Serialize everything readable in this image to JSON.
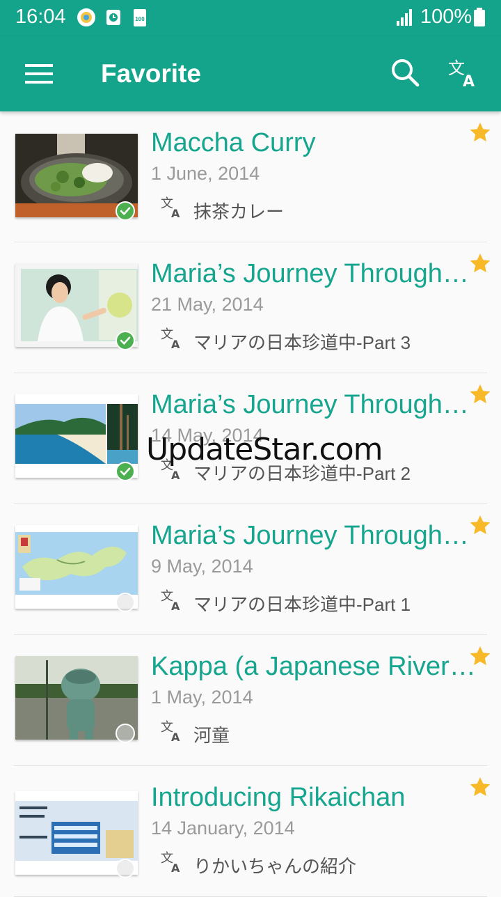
{
  "status_bar": {
    "time": "16:04",
    "battery": "100%",
    "notification_badge": "100"
  },
  "app_bar": {
    "title": "Favorite"
  },
  "items": [
    {
      "title": "Maccha Curry",
      "date": "1 June, 2014",
      "japanese": "抹茶カレー",
      "read": true,
      "favorite": true,
      "thumb": "green-curry"
    },
    {
      "title": "Maria’s Journey Through…",
      "date": "21 May, 2014",
      "japanese": "マリアの日本珍道中-Part 3",
      "read": true,
      "favorite": true,
      "thumb": "woman-at-map"
    },
    {
      "title": "Maria’s Journey Through…",
      "date": "14 May, 2014",
      "japanese": "マリアの日本珍道中-Part 2",
      "read": true,
      "favorite": true,
      "thumb": "beach-bay"
    },
    {
      "title": "Maria’s Journey Through…",
      "date": "9 May, 2014",
      "japanese": "マリアの日本珍道中-Part 1",
      "read": false,
      "favorite": true,
      "thumb": "island-map"
    },
    {
      "title": "Kappa (a Japanese River…",
      "date": "1 May, 2014",
      "japanese": "河童",
      "read": false,
      "favorite": true,
      "thumb": "kappa-statue"
    },
    {
      "title": "Introducing Rikaichan",
      "date": "14 January, 2014",
      "japanese": "りかいちゃんの紹介",
      "read": false,
      "favorite": true,
      "thumb": "japanese-text-screen"
    }
  ],
  "watermark": "UpdateStar.com",
  "colors": {
    "primary": "#14a38b",
    "title_text": "#16a58e",
    "star": "#f7b928",
    "check": "#4caf50"
  }
}
